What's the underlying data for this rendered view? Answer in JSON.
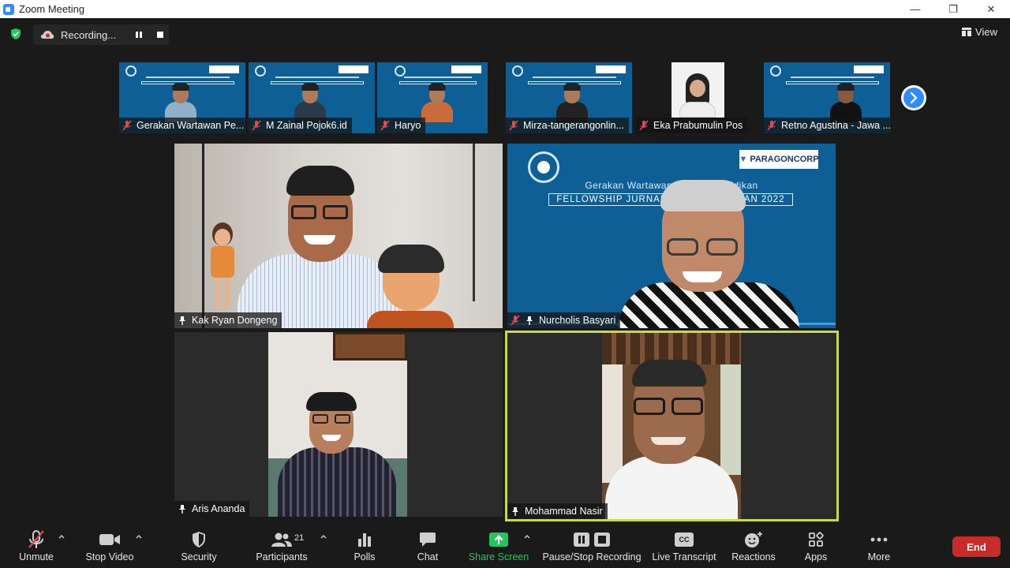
{
  "window": {
    "title": "Zoom Meeting",
    "controls": [
      "—",
      "❐",
      "✕"
    ]
  },
  "colors": {
    "accent": "#2d8cff",
    "banner": "#0e5f95",
    "active_speaker": "#c9d94a",
    "end": "#c92a2a",
    "share": "#22c55e"
  },
  "top": {
    "recording_label": "Recording...",
    "view_label": "View"
  },
  "thumbnails": [
    {
      "name": "Gerakan Wartawan Pe...",
      "muted": true
    },
    {
      "name": "M Zainal Pojok6.id",
      "muted": true
    },
    {
      "name": "Haryo",
      "muted": true
    },
    {
      "name": "Mirza-tangerangonlin...",
      "muted": true
    },
    {
      "name": "Eka Prabumulin Pos",
      "muted": true
    },
    {
      "name": "Retno Agustina - Jawa ...",
      "muted": true
    }
  ],
  "tiles": [
    {
      "name": "Kak Ryan Dongeng",
      "muted": false
    },
    {
      "name": "Nurcholis Basyari",
      "muted": true
    },
    {
      "name": "Aris Ananda",
      "muted": false
    },
    {
      "name": "Mohammad Nasir",
      "muted": false
    }
  ],
  "banner": {
    "line1": "Gerakan Wartawan Peduli Pendidikan",
    "line2": "FELLOWSHIP JURNALISME PENDIDIKAN 2022",
    "sponsor": "PARAGONCORP"
  },
  "toolbar": {
    "unmute": "Unmute",
    "stop_video": "Stop Video",
    "security": "Security",
    "participants": "Participants",
    "participants_count": "21",
    "polls": "Polls",
    "chat": "Chat",
    "share_screen": "Share Screen",
    "pause_stop_recording": "Pause/Stop Recording",
    "live_transcript": "Live Transcript",
    "cc": "CC",
    "reactions": "Reactions",
    "apps": "Apps",
    "more": "More",
    "end": "End"
  }
}
